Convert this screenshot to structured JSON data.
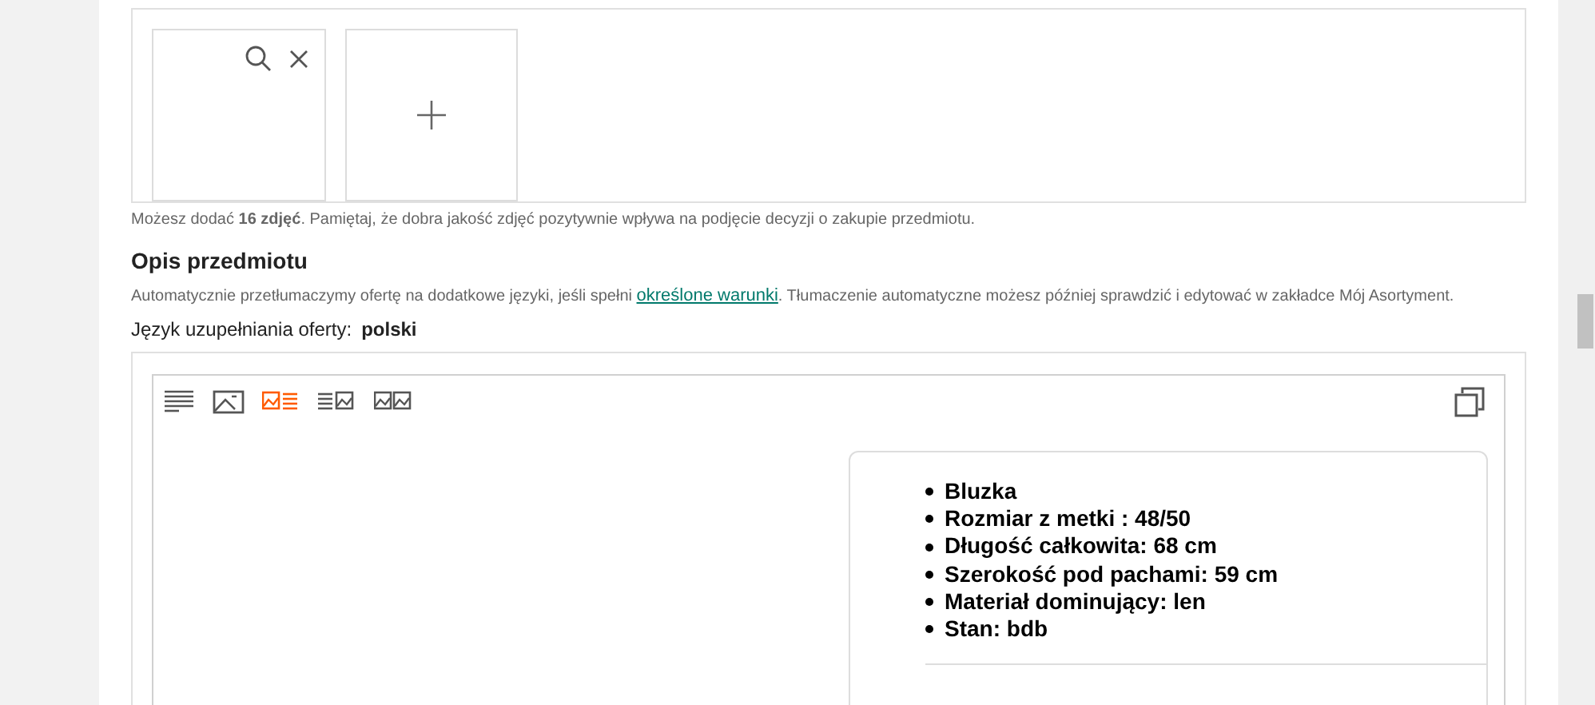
{
  "photos": {
    "tiles": [
      {
        "kind": "photo"
      },
      {
        "kind": "add"
      }
    ],
    "hint": "Możesz dodać **16 zdjęć**. Pamiętaj, że dobra jakość zdjęć pozytywnie wpływa na podjęcie decyzji o zakupie przedmiotu."
  },
  "description": {
    "title": "Opis przedmiotu",
    "info_before": "Automatycznie przetłumaczymy ofertę na dodatkowe języki, jeśli spełni",
    "info_link": "określone warunki",
    "info_after": ". Tłumaczenie automatyczne możesz później sprawdzić i edytować w zakładce Mój Asortyment.",
    "language_label": "Język uzupełniania oferty:",
    "language_value": "polski"
  },
  "editor": {
    "layouts": [
      {
        "kind": "text",
        "selected": false
      },
      {
        "kind": "image",
        "selected": false
      },
      {
        "kind": "image-text",
        "selected": true
      },
      {
        "kind": "text-image",
        "selected": false
      },
      {
        "kind": "image-image",
        "selected": false
      }
    ],
    "bullets": [
      "Bluzka",
      "Rozmiar z metki : 48/50",
      "Długość całkowita: 68 cm",
      "Szerokość pod pachami: 59 cm",
      "Materiał dominujący: len",
      "Stan: bdb"
    ]
  }
}
